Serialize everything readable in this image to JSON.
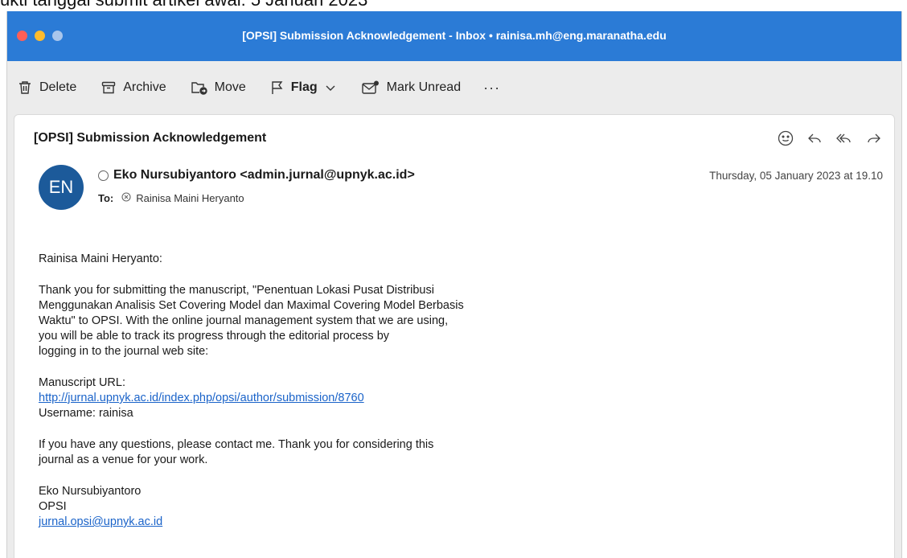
{
  "caption": "ukti tanggal submit artikel awal: 5 Januari 2023",
  "window": {
    "title": "[OPSI] Submission Acknowledgement - Inbox • rainisa.mh@eng.maranatha.edu"
  },
  "toolbar": {
    "delete": "Delete",
    "archive": "Archive",
    "move": "Move",
    "flag": "Flag",
    "mark_unread": "Mark Unread",
    "more": "···"
  },
  "email": {
    "subject": "[OPSI] Submission Acknowledgement",
    "avatar_initials": "EN",
    "sender": "Eko Nursubiyantoro <admin.jurnal@upnyk.ac.id>",
    "to_label": "To:",
    "recipient": "Rainisa Maini Heryanto",
    "date": "Thursday, 05 January 2023 at 19.10",
    "greeting": "Rainisa Maini Heryanto:",
    "para1_lines": [
      "Thank you for submitting the manuscript, \"Penentuan Lokasi Pusat Distribusi",
      "Menggunakan Analisis Set Covering Model dan Maximal Covering Model Berbasis",
      "Waktu\" to OPSI. With the online journal management system that we are using,",
      "you will be able to track its progress through the editorial process by",
      "logging in to the journal web site:"
    ],
    "manuscript_label": "Manuscript URL:",
    "manuscript_url": "http://jurnal.upnyk.ac.id/index.php/opsi/author/submission/8760",
    "username": "Username: rainisa",
    "para2_lines": [
      "If you have any questions, please contact me. Thank you for considering this",
      "journal as a venue for your work."
    ],
    "signature_name": "Eko Nursubiyantoro",
    "signature_org": "OPSI",
    "signature_email": "jurnal.opsi@upnyk.ac.id"
  },
  "colors": {
    "titlebar": "#2b7bd6",
    "avatar": "#1c5a9a",
    "link": "#1a63c9"
  }
}
